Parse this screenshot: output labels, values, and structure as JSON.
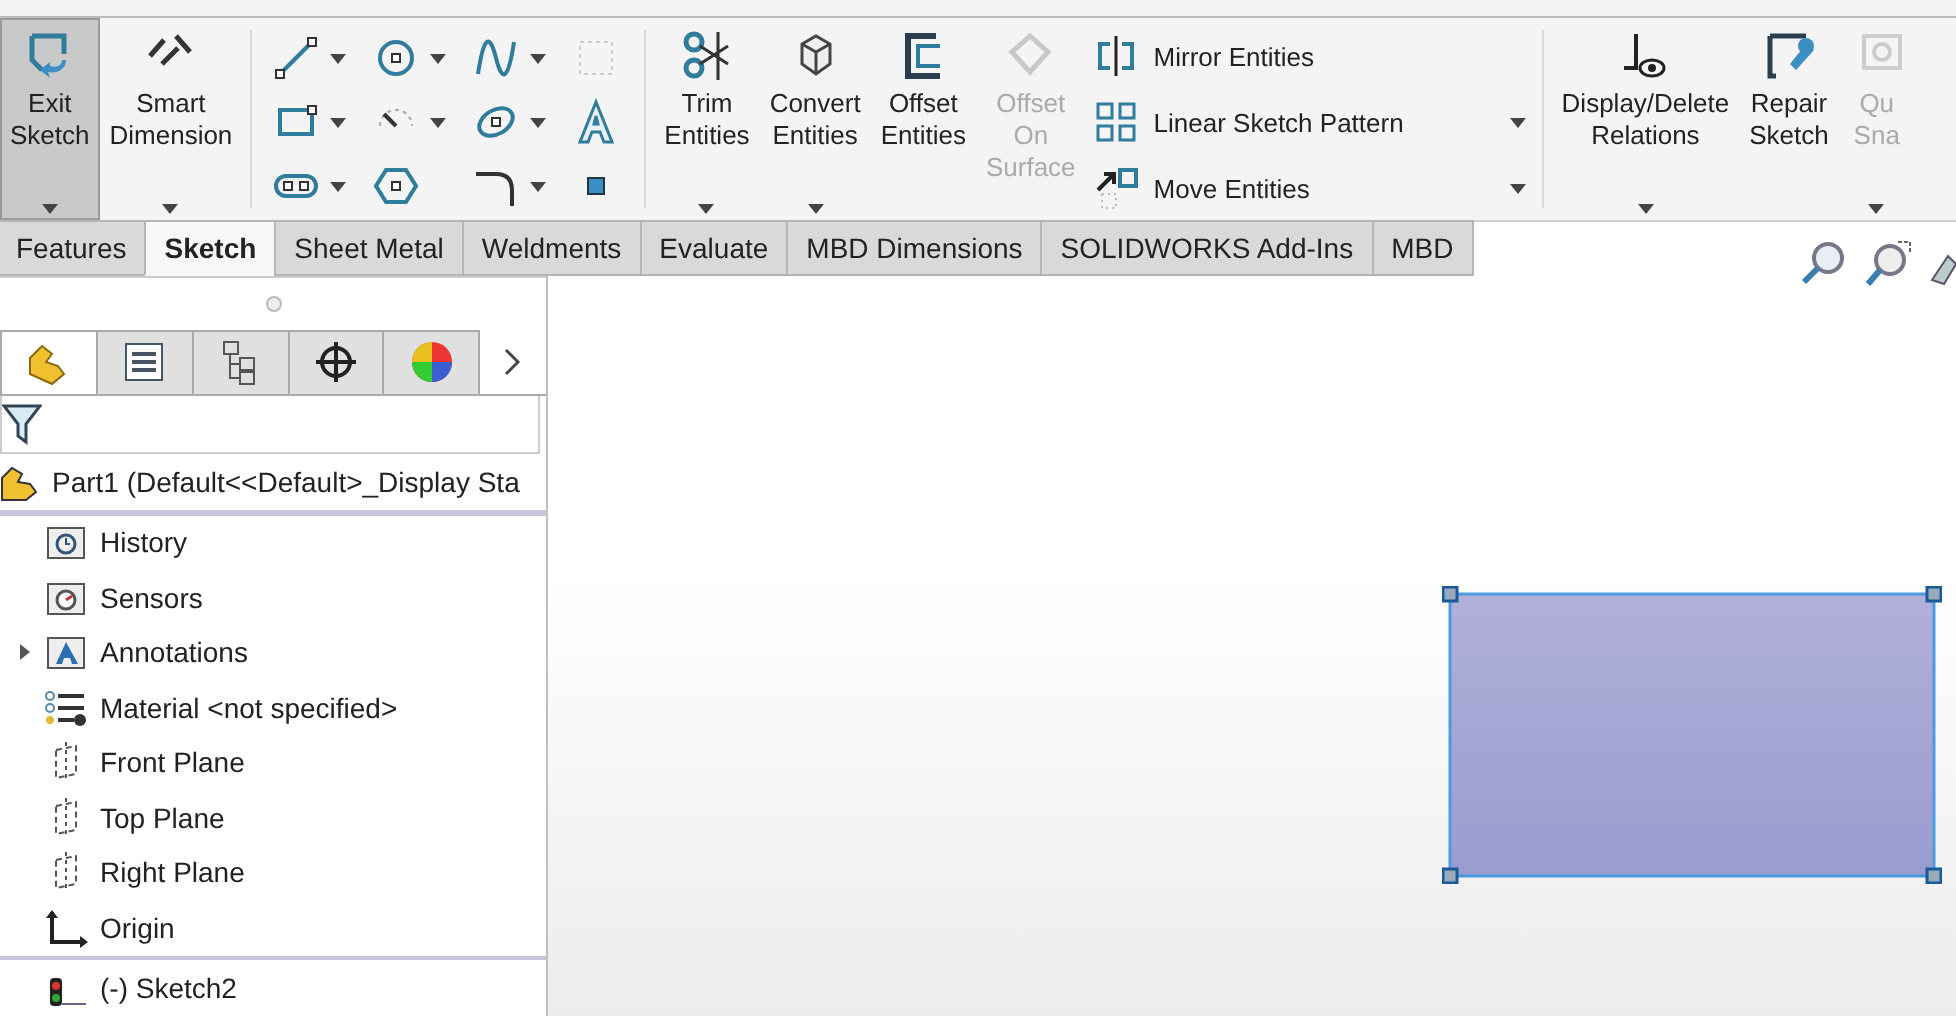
{
  "ribbon": {
    "buttons": [
      {
        "kind": "exit-sketch",
        "lines": [
          "Exit",
          "Sketch"
        ],
        "pressed": true,
        "disabled": false,
        "dropdown": true
      },
      {
        "kind": "smart-dimension",
        "lines": [
          "Smart",
          "Dimension"
        ],
        "pressed": false,
        "disabled": false,
        "dropdown": true
      }
    ],
    "tools": [
      {
        "kind": "trim",
        "lines": [
          "Trim",
          "Entities"
        ],
        "disabled": false,
        "dropdown": true
      },
      {
        "kind": "convert",
        "lines": [
          "Convert",
          "Entities"
        ],
        "disabled": false,
        "dropdown": true
      },
      {
        "kind": "offset",
        "lines": [
          "Offset",
          "Entities"
        ],
        "disabled": false,
        "dropdown": false
      },
      {
        "kind": "offset-surface",
        "lines": [
          "Offset",
          "On",
          "Surface"
        ],
        "disabled": true,
        "dropdown": false
      }
    ],
    "list": [
      {
        "kind": "mirror",
        "label": "Mirror Entities",
        "dropdown": false
      },
      {
        "kind": "pattern",
        "label": "Linear Sketch Pattern",
        "dropdown": true
      },
      {
        "kind": "move",
        "label": "Move Entities",
        "dropdown": true
      }
    ],
    "relations": [
      {
        "kind": "relations",
        "lines": [
          "Display/Delete",
          "Relations"
        ],
        "disabled": false,
        "dropdown": true
      },
      {
        "kind": "repair",
        "lines": [
          "Repair",
          "Sketch"
        ],
        "disabled": false,
        "dropdown": false
      },
      {
        "kind": "snaps",
        "lines": [
          "Qu",
          "Sna"
        ],
        "disabled": true,
        "dropdown": true
      }
    ]
  },
  "tabs": [
    {
      "label": "Features",
      "selected": false
    },
    {
      "label": "Sketch",
      "selected": true
    },
    {
      "label": "Sheet Metal",
      "selected": false
    },
    {
      "label": "Weldments",
      "selected": false
    },
    {
      "label": "Evaluate",
      "selected": false
    },
    {
      "label": "MBD Dimensions",
      "selected": false
    },
    {
      "label": "SOLIDWORKS Add-Ins",
      "selected": false
    },
    {
      "label": "MBD",
      "selected": false
    }
  ],
  "panel_tabs": [
    {
      "kind": "feature-tree",
      "selected": true
    },
    {
      "kind": "property",
      "selected": false
    },
    {
      "kind": "configuration",
      "selected": false
    },
    {
      "kind": "crosshair",
      "selected": false
    },
    {
      "kind": "appearance",
      "selected": false
    }
  ],
  "tree": {
    "root": "Part1  (Default<<Default>_Display Sta",
    "items": [
      {
        "kind": "history",
        "label": "History"
      },
      {
        "kind": "sensors",
        "label": "Sensors"
      },
      {
        "kind": "annotations",
        "label": "Annotations",
        "expanded": false
      },
      {
        "kind": "material",
        "label": "Material <not specified>"
      },
      {
        "kind": "plane",
        "label": "Front Plane"
      },
      {
        "kind": "plane",
        "label": "Top Plane"
      },
      {
        "kind": "plane",
        "label": "Right Plane"
      },
      {
        "kind": "origin",
        "label": "Origin"
      },
      {
        "kind": "sketch",
        "label": "(-) Sketch2",
        "rollback": true
      }
    ]
  }
}
